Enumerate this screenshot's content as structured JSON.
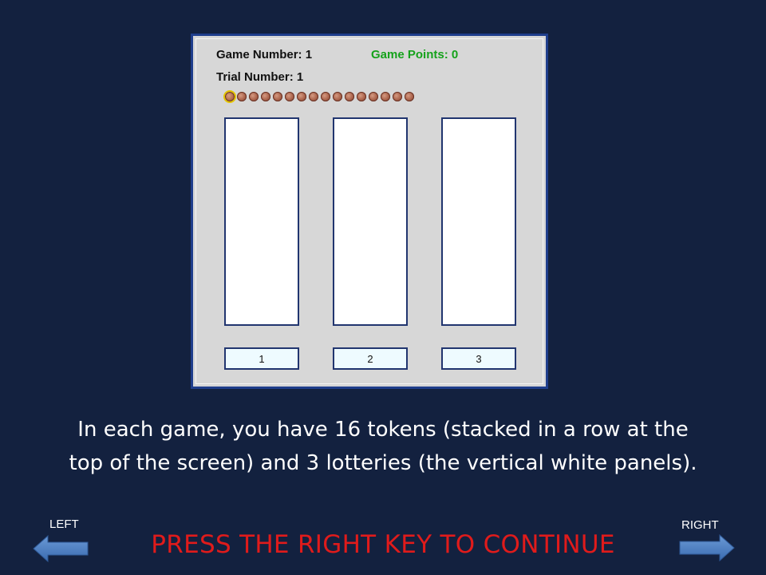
{
  "game": {
    "game_number_label": "Game Number: 1",
    "game_points_label": "Game Points: 0",
    "trial_number_label": "Trial Number: 1",
    "token_count": 16,
    "selected_token_index": 0,
    "colors": {
      "frame_border": "#1f3e8c",
      "points_text": "#15a21b",
      "token_highlight": "#e3c400"
    }
  },
  "lotteries": [
    {
      "label": "1"
    },
    {
      "label": "2"
    },
    {
      "label": "3"
    }
  ],
  "instruction": {
    "line1": "In each game, you have 16 tokens (stacked in a row at the",
    "line2": "top of the screen) and 3 lotteries (the vertical white panels)."
  },
  "navigation": {
    "left_label": "LEFT",
    "right_label": "RIGHT",
    "left_icon": "left-arrow-icon",
    "right_icon": "right-arrow-icon",
    "arrow_color": "#4a7fc4"
  },
  "prompt": {
    "text": "PRESS THE RIGHT KEY TO CONTINUE",
    "color": "#e01b1b"
  },
  "background_color": "#13213f"
}
